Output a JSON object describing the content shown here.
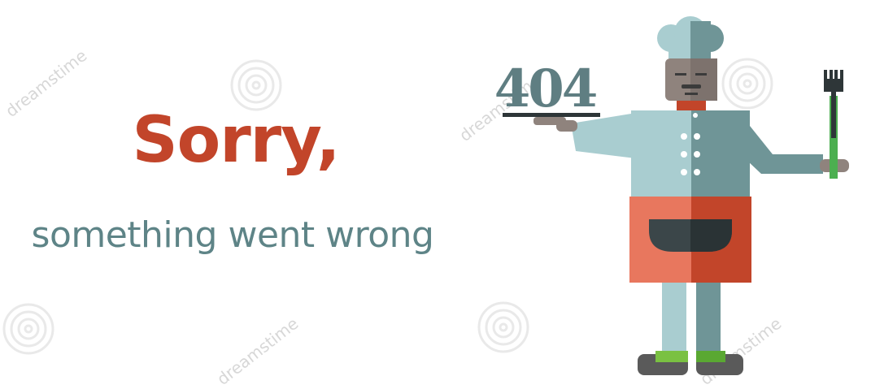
{
  "message": {
    "title": "Sorry,",
    "subtitle": "something went wrong"
  },
  "illustration": {
    "error_code": "404",
    "watermark_text": "dreamstime"
  },
  "colors": {
    "title": "#c2452a",
    "subtitle": "#5e8487",
    "chef_jacket_light": "#a9cdd0",
    "chef_jacket_dark": "#6f9597",
    "apron_light": "#e8775e",
    "apron_dark": "#c2452a",
    "pocket": "#3b4649",
    "skin": "#8f837d"
  }
}
